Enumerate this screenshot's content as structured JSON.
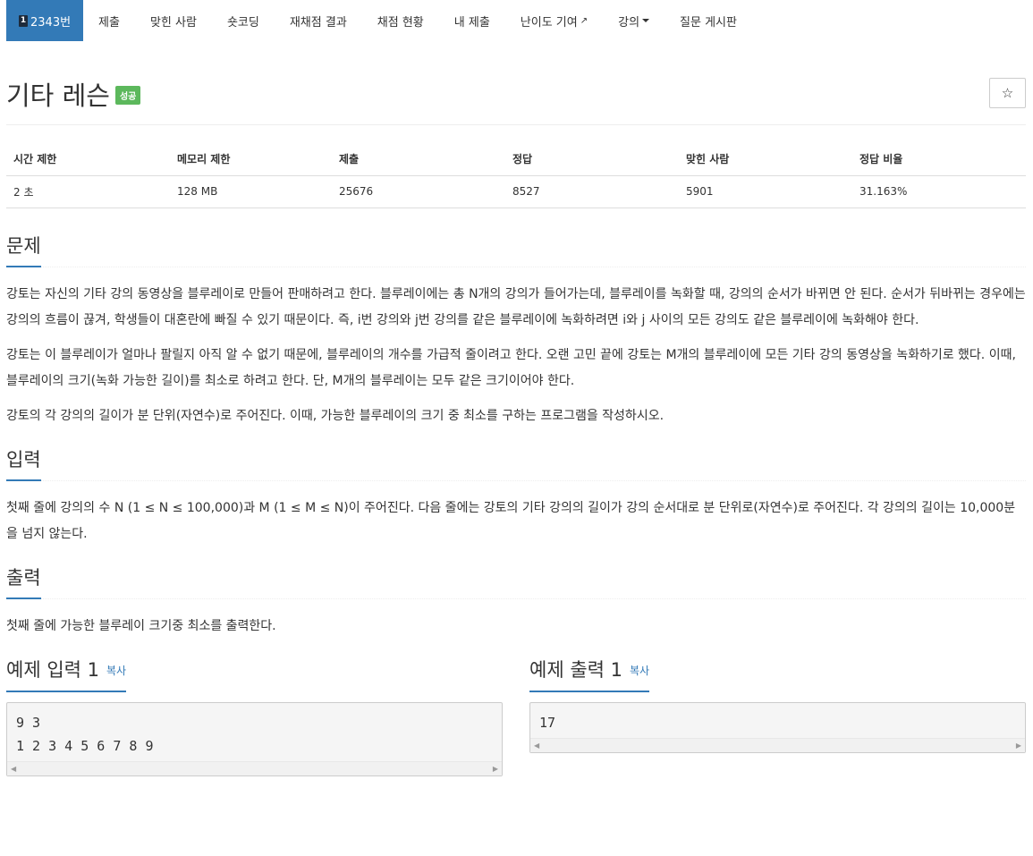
{
  "nav": {
    "problem_number": "2343번",
    "problem_badge": "1",
    "items": [
      "제출",
      "맞힌 사람",
      "숏코딩",
      "재채점 결과",
      "채점 현황",
      "내 제출",
      "난이도 기여",
      "강의",
      "질문 게시판"
    ]
  },
  "problem": {
    "title": "기타 레슨",
    "status_label": "성공",
    "star": "☆"
  },
  "info": {
    "headers": [
      "시간 제한",
      "메모리 제한",
      "제출",
      "정답",
      "맞힌 사람",
      "정답 비율"
    ],
    "values": [
      "2 초",
      "128 MB",
      "25676",
      "8527",
      "5901",
      "31.163%"
    ]
  },
  "sections": {
    "problem_heading": "문제",
    "problem_paragraphs": [
      "강토는 자신의 기타 강의 동영상을 블루레이로 만들어 판매하려고 한다. 블루레이에는 총 N개의 강의가 들어가는데, 블루레이를 녹화할 때, 강의의 순서가 바뀌면 안 된다. 순서가 뒤바뀌는 경우에는 강의의 흐름이 끊겨, 학생들이 대혼란에 빠질 수 있기 때문이다. 즉, i번 강의와 j번 강의를 같은 블루레이에 녹화하려면 i와 j 사이의 모든 강의도 같은 블루레이에 녹화해야 한다.",
      "강토는 이 블루레이가 얼마나 팔릴지 아직 알 수 없기 때문에, 블루레이의 개수를 가급적 줄이려고 한다. 오랜 고민 끝에 강토는 M개의 블루레이에 모든 기타 강의 동영상을 녹화하기로 했다. 이때, 블루레이의 크기(녹화 가능한 길이)를 최소로 하려고 한다. 단, M개의 블루레이는 모두 같은 크기이어야 한다.",
      "강토의 각 강의의 길이가 분 단위(자연수)로 주어진다. 이때, 가능한 블루레이의 크기 중 최소를 구하는 프로그램을 작성하시오."
    ],
    "input_heading": "입력",
    "input_text": "첫째 줄에 강의의 수 N (1 ≤ N ≤ 100,000)과 M (1 ≤ M ≤ N)이 주어진다. 다음 줄에는 강토의 기타 강의의 길이가 강의 순서대로 분 단위로(자연수)로 주어진다. 각 강의의 길이는 10,000분을 넘지 않는다.",
    "output_heading": "출력",
    "output_text": "첫째 줄에 가능한 블루레이 크기중 최소를 출력한다."
  },
  "samples": {
    "input_title": "예제 입력 1",
    "output_title": "예제 출력 1",
    "copy_label": "복사",
    "input_code": "9 3\n1 2 3 4 5 6 7 8 9",
    "output_code": "17"
  },
  "colors": {
    "accent": "#337ab7",
    "success": "#5cb85c"
  }
}
